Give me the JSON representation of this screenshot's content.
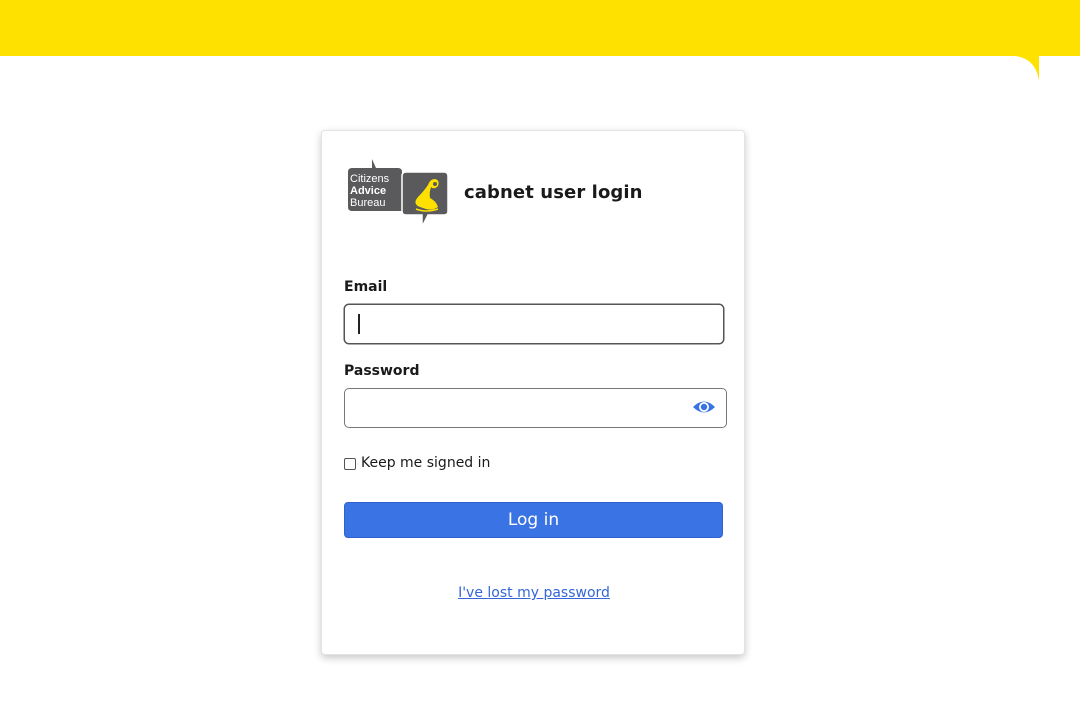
{
  "brand": {
    "logo_alt": "Citizens Advice Bureau",
    "logo_lines": [
      "Citizens",
      "Advice",
      "Bureau"
    ],
    "colors": {
      "banner_yellow": "#ffe100",
      "logo_grey": "#5a5a5c",
      "logo_yellow": "#ffe100",
      "primary_blue": "#3a73e4"
    }
  },
  "login": {
    "title": "cabnet user login",
    "email_label": "Email",
    "email_value": "",
    "password_label": "Password",
    "password_value": "",
    "show_password_icon": "eye-icon",
    "keep_signed_in_label": "Keep me signed in",
    "keep_signed_in_checked": false,
    "submit_label": "Log in",
    "lost_password_link": "I've lost my password"
  }
}
